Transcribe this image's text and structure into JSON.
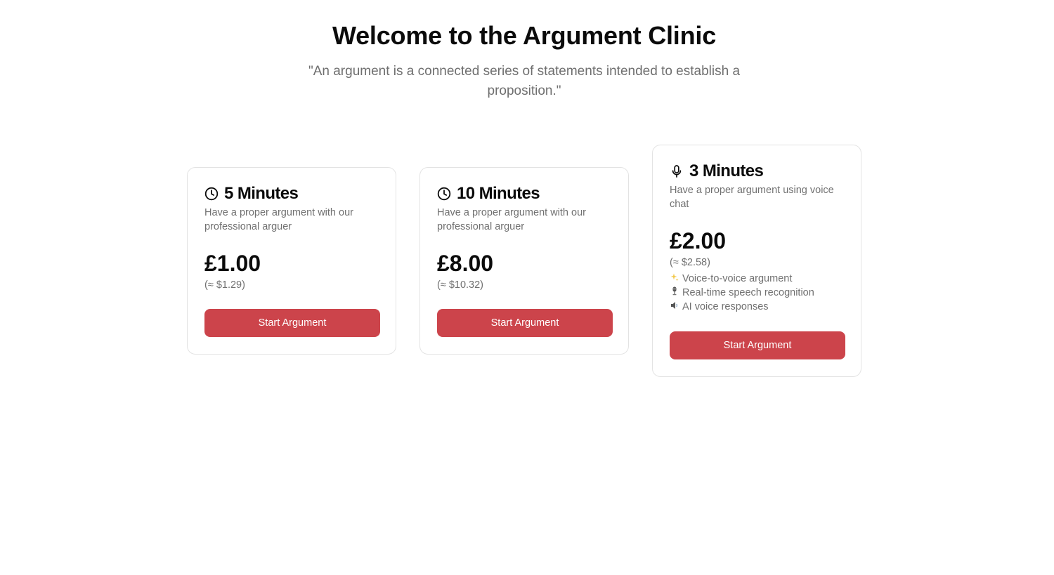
{
  "hero": {
    "title": "Welcome to the Argument Clinic",
    "quote": "\"An argument is a connected series of statements intended to establish a proposition.\""
  },
  "plans": [
    {
      "icon": "clock-icon",
      "title": "5 Minutes",
      "description": "Have a proper argument with our professional arguer",
      "price": "£1.00",
      "usd": "(≈ $1.29)",
      "button": "Start Argument"
    },
    {
      "icon": "clock-icon",
      "title": "10 Minutes",
      "description": "Have a proper argument with our professional arguer",
      "price": "£8.00",
      "usd": "(≈ $10.32)",
      "button": "Start Argument"
    },
    {
      "icon": "microphone-icon",
      "title": "3 Minutes",
      "description": "Have a proper argument using voice chat",
      "price": "£2.00",
      "usd": "(≈ $2.58)",
      "features": [
        {
          "icon": "sparkles-icon",
          "label": "Voice-to-voice argument"
        },
        {
          "icon": "studio-microphone-icon",
          "label": "Real-time speech recognition"
        },
        {
          "icon": "speaker-icon",
          "label": "AI voice responses"
        }
      ],
      "button": "Start Argument"
    }
  ],
  "colors": {
    "accent": "#cc444b",
    "text": "#0b0b0b",
    "muted": "#707070",
    "border": "#e3e3e3"
  }
}
